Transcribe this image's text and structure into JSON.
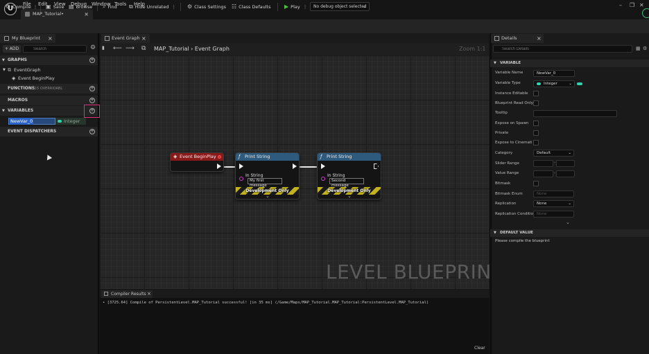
{
  "menu": {
    "logo": "U",
    "items": [
      "File",
      "Edit",
      "View",
      "Debug",
      "Window",
      "Tools",
      "Help"
    ],
    "doc_tab": "MAP_Tutorial•"
  },
  "toolbar": {
    "compile": "Compile",
    "save": "Save",
    "browse": "Browse",
    "find": "Find",
    "hide_unrelated": "Hide Unrelated",
    "class_settings": "Class Settings",
    "class_defaults": "Class Defaults",
    "play": "Play",
    "debug_object": "No debug object selected"
  },
  "my_blueprint": {
    "tab": "My Blueprint",
    "add": "+ ADD",
    "search_placeholder": "Search",
    "graphs_header": "GRAPHS",
    "event_graph": "EventGraph",
    "event_beginplay": "Event BeginPlay",
    "functions_header": "FUNCTIONS",
    "functions_hint": "(15 OVERRIDABL",
    "macros_header": "MACROS",
    "variables_header": "VARIABLES",
    "variable": {
      "name": "NewVar_0",
      "type": "Integer"
    },
    "dispatchers_header": "EVENT DISPATCHERS"
  },
  "graph": {
    "tab": "Event Graph",
    "breadcrumb": "MAP_Tutorial  ›  Event Graph",
    "zoom": "Zoom 1:1",
    "watermark": "LEVEL BLUEPRINT",
    "nodes": {
      "begin_play": {
        "title": "Event BeginPlay"
      },
      "print1": {
        "title": "Print String",
        "pin_label": "In String",
        "value": "My first message",
        "dev": "Development Only"
      },
      "print2": {
        "title": "Print String",
        "pin_label": "In String",
        "value": "Second message",
        "dev": "Development Only"
      }
    },
    "colors": {
      "event_header": "#8a1a1a",
      "function_header": "#2e5a7e",
      "string_pin": "#d03cd2",
      "integer": "#34d1b0"
    }
  },
  "compiler_results": {
    "tab": "Compiler Results",
    "message": "• [3725.64] Compile of PersistentLevel.MAP_Tutorial successful! [in 35 ms] (/Game/Maps/MAP_Tutorial.MAP_Tutorial:PersistentLevel.MAP_Tutorial)",
    "clear": "Clear"
  },
  "details": {
    "tab": "Details",
    "search_placeholder": "Search Details",
    "variable_section": "VARIABLE",
    "props": {
      "variable_name": {
        "label": "Variable Name",
        "value": "NewVar_0"
      },
      "variable_type": {
        "label": "Variable Type",
        "value": "Integer"
      },
      "instance_editable": {
        "label": "Instance Editable"
      },
      "blueprint_read_only": {
        "label": "Blueprint Read Only"
      },
      "tooltip": {
        "label": "Tooltip"
      },
      "expose_on_spawn": {
        "label": "Expose on Spawn"
      },
      "private": {
        "label": "Private"
      },
      "expose_to_cinematics": {
        "label": "Expose to Cinemati"
      },
      "category": {
        "label": "Category",
        "value": "Default"
      },
      "slider_range": {
        "label": "Slider Range",
        "separator": "-"
      },
      "value_range": {
        "label": "Value Range",
        "separator": "-"
      },
      "bitmask": {
        "label": "Bitmask"
      },
      "bitmask_enum": {
        "label": "Bitmask Enum",
        "value": "None"
      },
      "replication": {
        "label": "Replication",
        "value": "None"
      },
      "replication_condition": {
        "label": "Replication Conditio",
        "value": "None"
      }
    },
    "default_section": "DEFAULT VALUE",
    "compile_msg": "Please compile the blueprint"
  }
}
